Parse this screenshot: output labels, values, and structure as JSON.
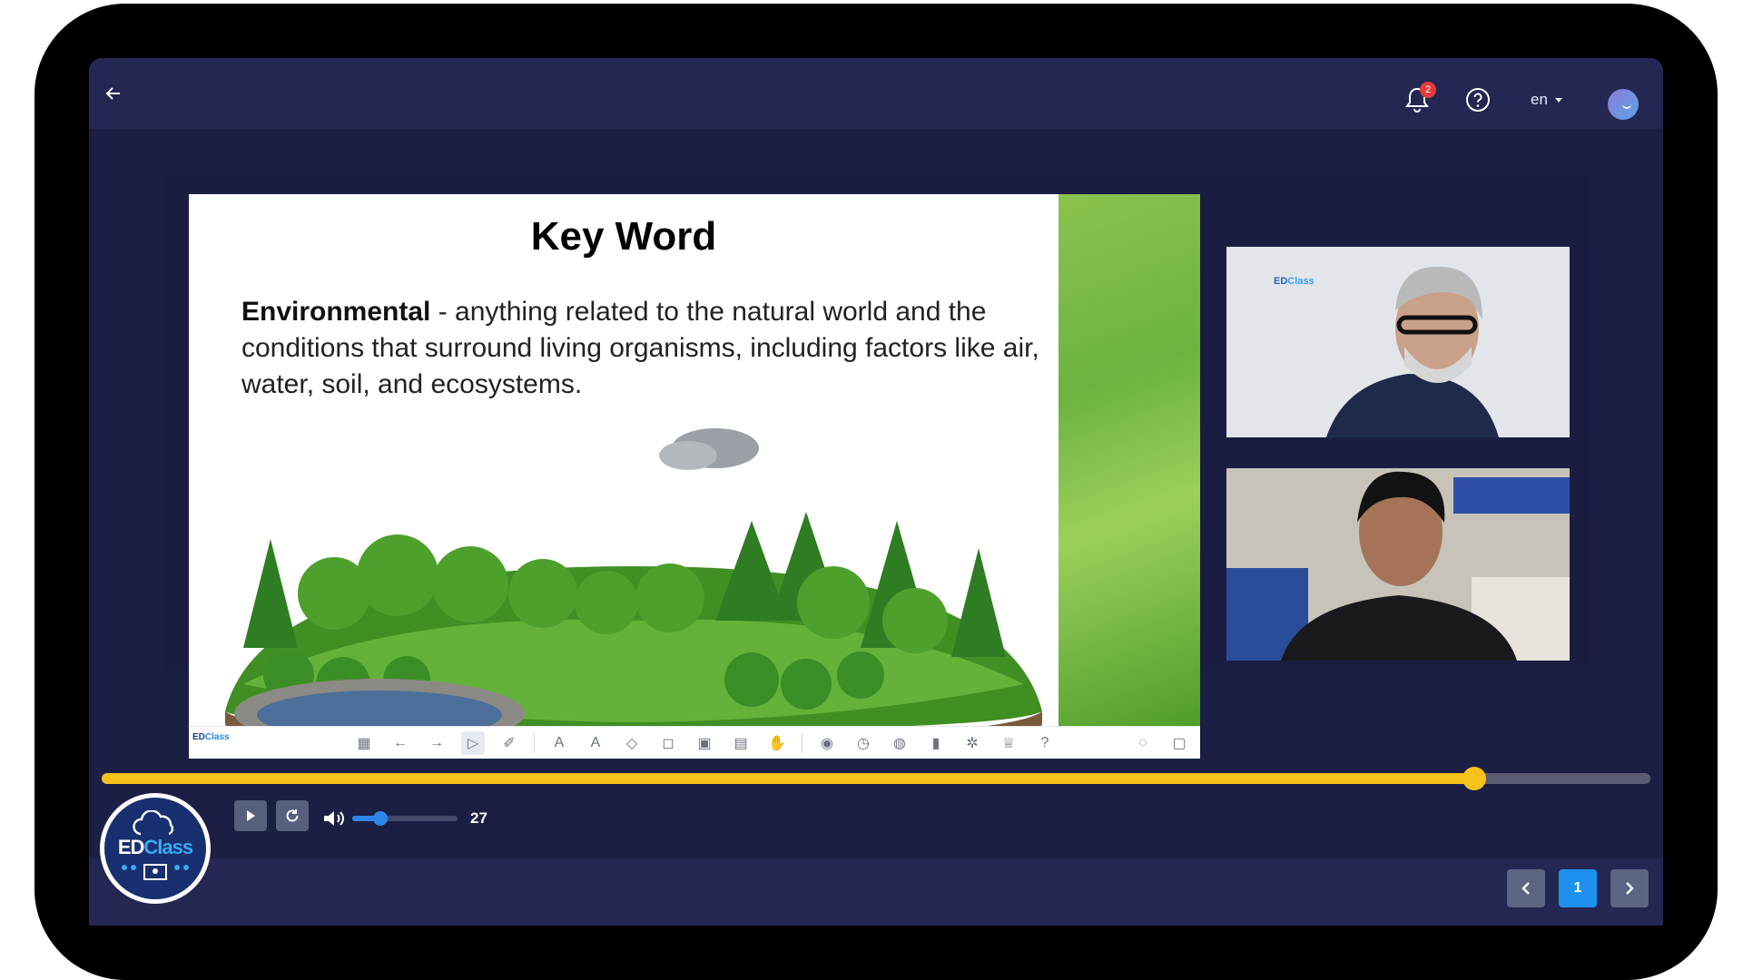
{
  "header": {
    "notification_count": "2",
    "language": "en"
  },
  "slide": {
    "title": "Key Word",
    "term": "Environmental",
    "definition": " - anything related to the natural world and the conditions that surround living organisms, including factors like air, water, soil, and ecosystems."
  },
  "slide_toolbar": {
    "logo": "ED",
    "logo_accent": "Class",
    "tools": [
      "grid-icon",
      "undo-arrow-icon",
      "redo-arrow-icon",
      "pointer-icon",
      "laser-icon",
      "pen-icon",
      "highlighter-icon",
      "eraser-icon",
      "shapes-icon",
      "text-icon",
      "board-icon",
      "hand-icon",
      "ai-icon",
      "timer-icon",
      "browser-icon",
      "chart-icon",
      "wheel-icon",
      "trophy-icon",
      "help-icon"
    ],
    "right_tools": [
      "hide-icon",
      "present-icon"
    ]
  },
  "videos": {
    "logo_ed": "ED",
    "logo_class": "Class"
  },
  "playback": {
    "progress": 0.886,
    "volume_fraction": 0.27,
    "volume_value": "27"
  },
  "pagination": {
    "current_page": "1"
  },
  "brand": {
    "ed": "ED",
    "class": "Class"
  },
  "colors": {
    "accent": "#f7c21a",
    "primary": "#1e90ef",
    "background": "#1c1f44"
  }
}
